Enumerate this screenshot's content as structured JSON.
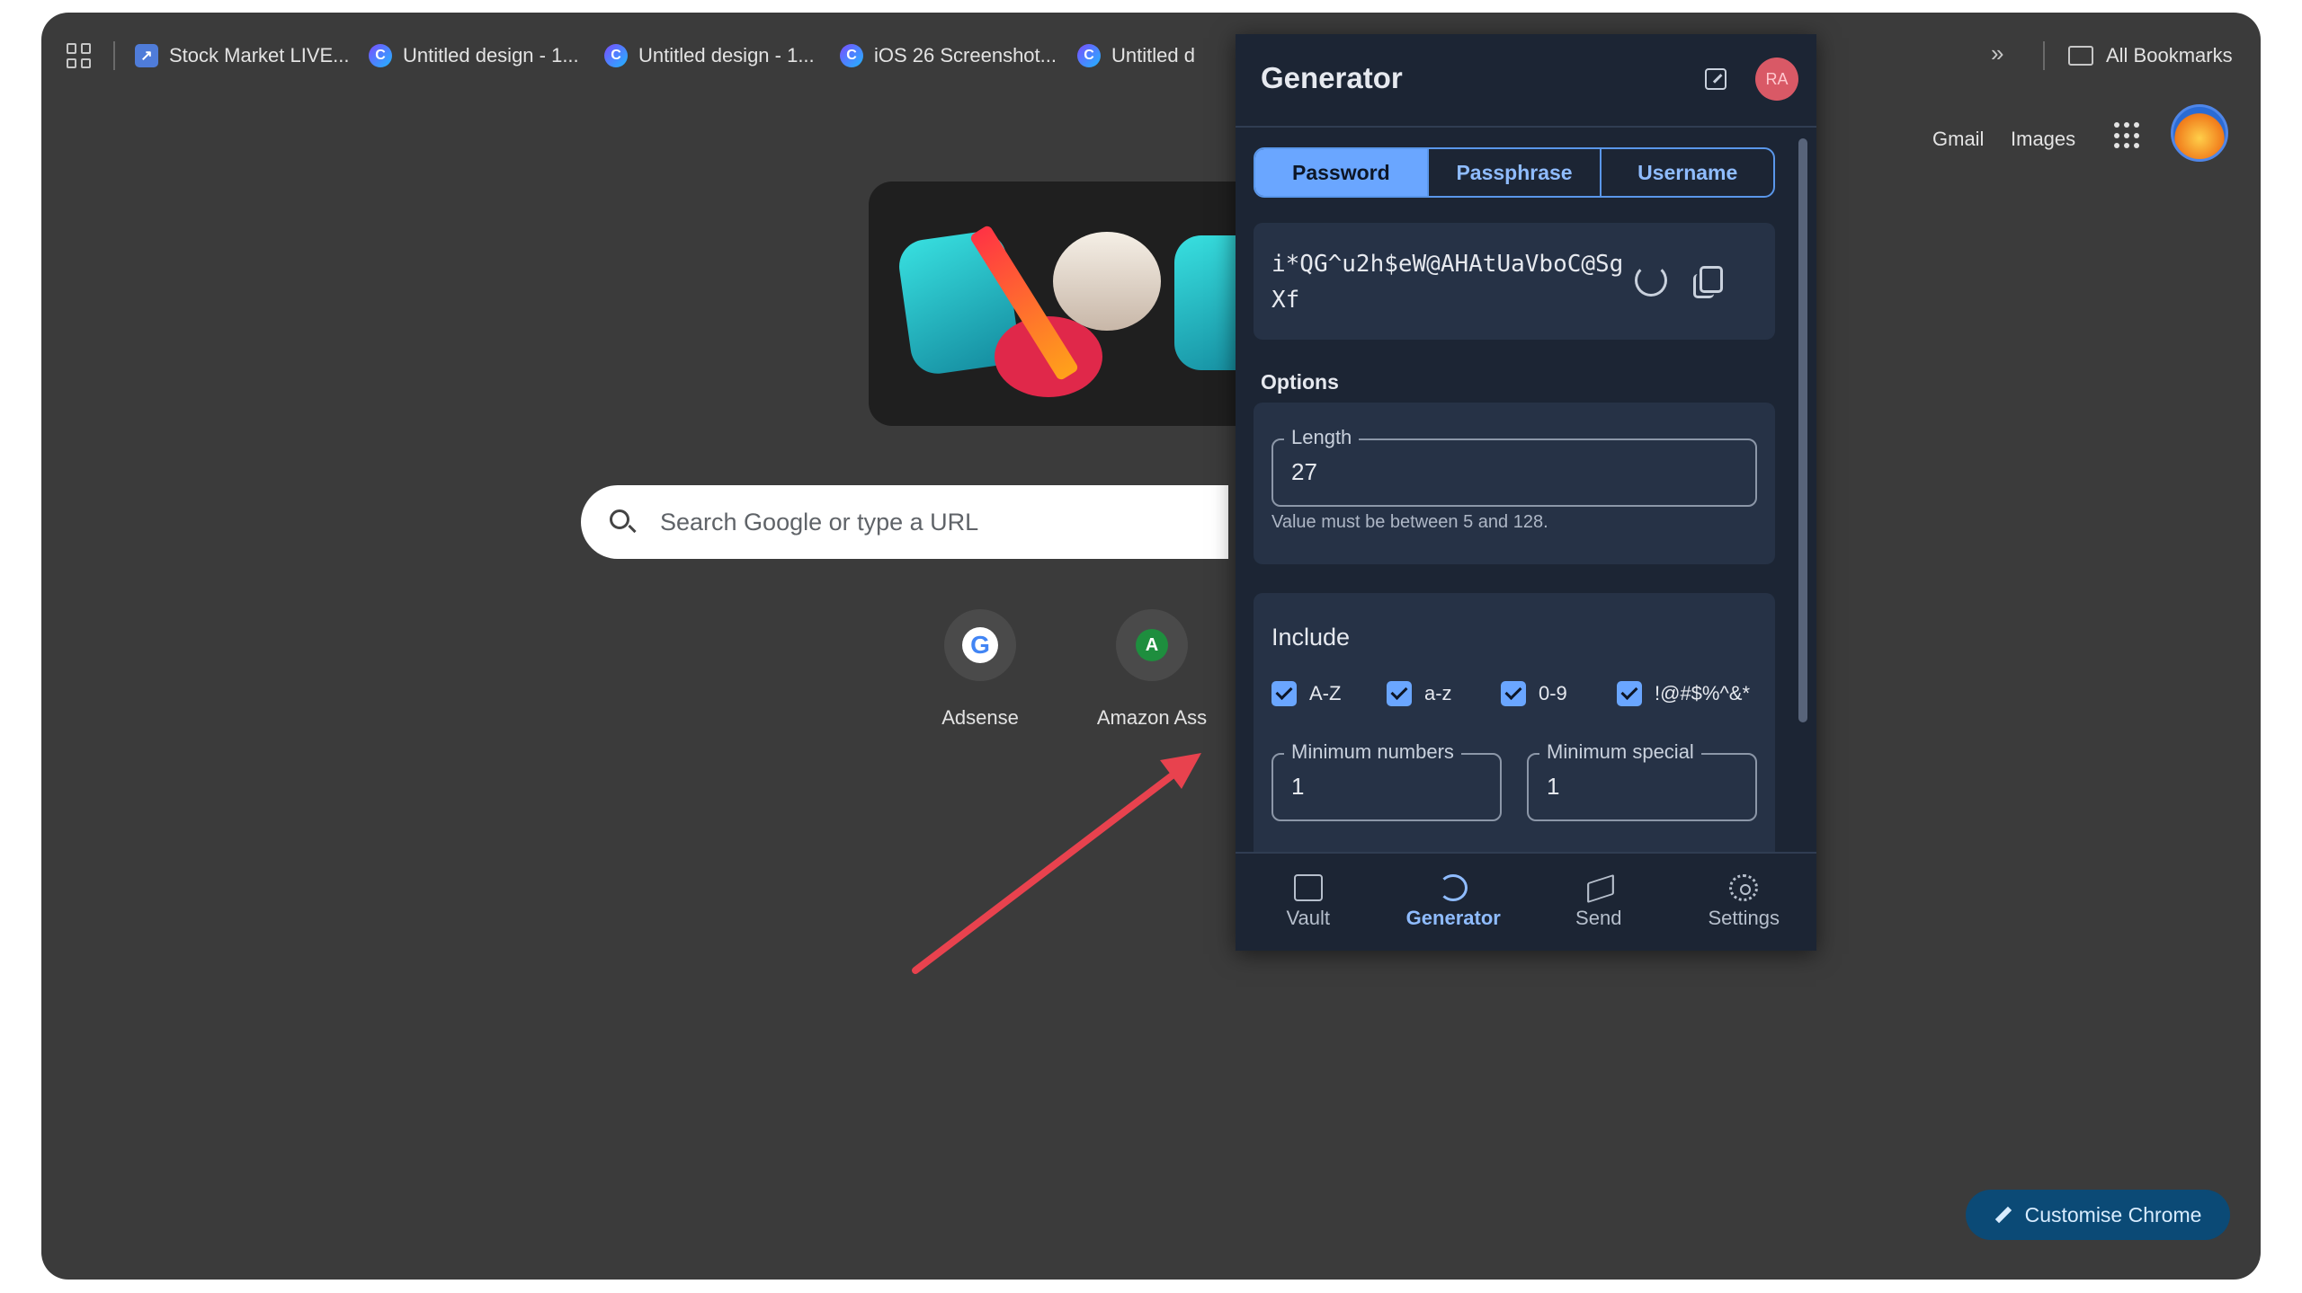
{
  "bookmarks": {
    "items": [
      {
        "label": "Stock Market LIVE..."
      },
      {
        "label": "Untitled design - 1..."
      },
      {
        "label": "Untitled design - 1..."
      },
      {
        "label": "iOS 26 Screenshot..."
      },
      {
        "label": "Untitled d"
      }
    ],
    "all_bookmarks": "All Bookmarks",
    "more": "»"
  },
  "header_links": {
    "gmail": "Gmail",
    "images": "Images"
  },
  "search": {
    "placeholder": "Search Google or type a URL"
  },
  "shortcuts": [
    {
      "label": "Adsense",
      "icon_letter": "G"
    },
    {
      "label": "Amazon Ass",
      "icon_letter": "A"
    }
  ],
  "customise": {
    "label": "Customise Chrome"
  },
  "popup": {
    "title": "Generator",
    "avatar": "RA",
    "tabs": [
      "Password",
      "Passphrase",
      "Username"
    ],
    "password": "i*QG^u2h$eW@AHAtUaVboC@SgXf",
    "options_label": "Options",
    "length": {
      "label": "Length",
      "value": "27",
      "hint": "Value must be between 5 and 128."
    },
    "include": {
      "title": "Include",
      "checks": [
        {
          "label": "A-Z",
          "checked": true
        },
        {
          "label": "a-z",
          "checked": true
        },
        {
          "label": "0-9",
          "checked": true
        },
        {
          "label": "!@#$%^&*",
          "checked": true
        }
      ],
      "min_numbers": {
        "label": "Minimum numbers",
        "value": "1"
      },
      "min_special": {
        "label": "Minimum special",
        "value": "1"
      }
    },
    "nav": [
      "Vault",
      "Generator",
      "Send",
      "Settings"
    ]
  },
  "colors": {
    "accent": "#6aa6ff",
    "panel": "#1c2534",
    "arrow": "#e8424e"
  }
}
